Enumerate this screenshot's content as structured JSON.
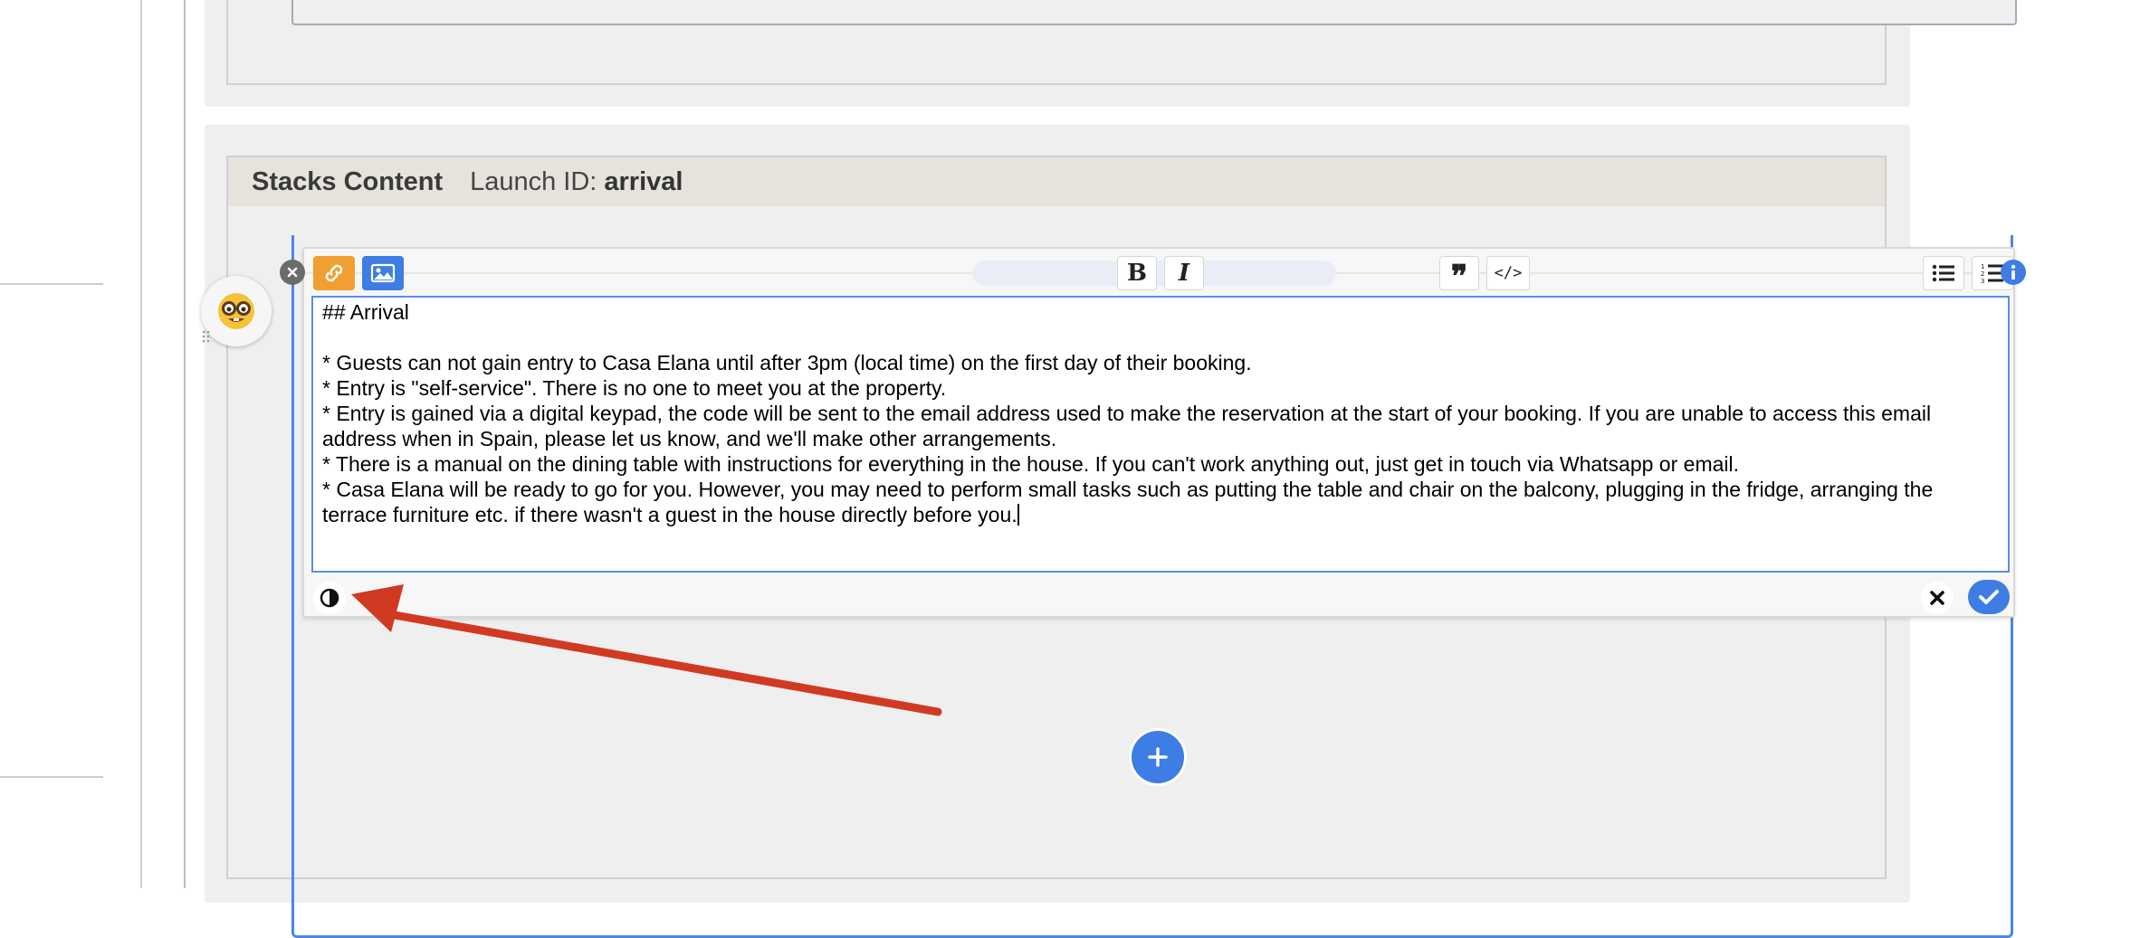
{
  "stack": {
    "title": "Stacks Content",
    "launch_label": "Launch ID:",
    "launch_id": "arrival"
  },
  "editor": {
    "text_lines": [
      "## Arrival",
      "",
      "* Guests can not gain entry to Casa Elana until after 3pm (local time) on the first day of their booking.",
      "* Entry is \"self-service\". There is no one to meet you at the property.",
      "* Entry is gained via a digital keypad, the code will be sent to the email address used to make the reservation at the start of your booking. If you are unable to access this email address when in Spain, please let us know, and we'll make other arrangements.",
      "* There is a manual on the dining table with instructions for everything in the house. If you can't work anything out, just get in touch via Whatsapp or email.",
      "* Casa Elana will be ready to go for you. However, you may need to perform small tasks such as putting the table and chair on the balcony, plugging in the fridge, arranging the terrace furniture etc. if there wasn't a guest in the house directly before you."
    ],
    "toolbar": {
      "bold": "B",
      "italic": "I",
      "quote": "❞",
      "code": "</>"
    }
  },
  "colors": {
    "accent": "#3d7de4",
    "link_button": "#f0a030",
    "annotation_arrow": "#d13a22"
  },
  "icons": {
    "avatar": "nerd-face-emoji",
    "link": "link-icon",
    "image": "image-icon",
    "contrast": "contrast-icon",
    "cancel": "close-icon",
    "confirm": "check-icon",
    "add": "plus-icon",
    "remove": "remove-icon",
    "info": "info-icon"
  }
}
